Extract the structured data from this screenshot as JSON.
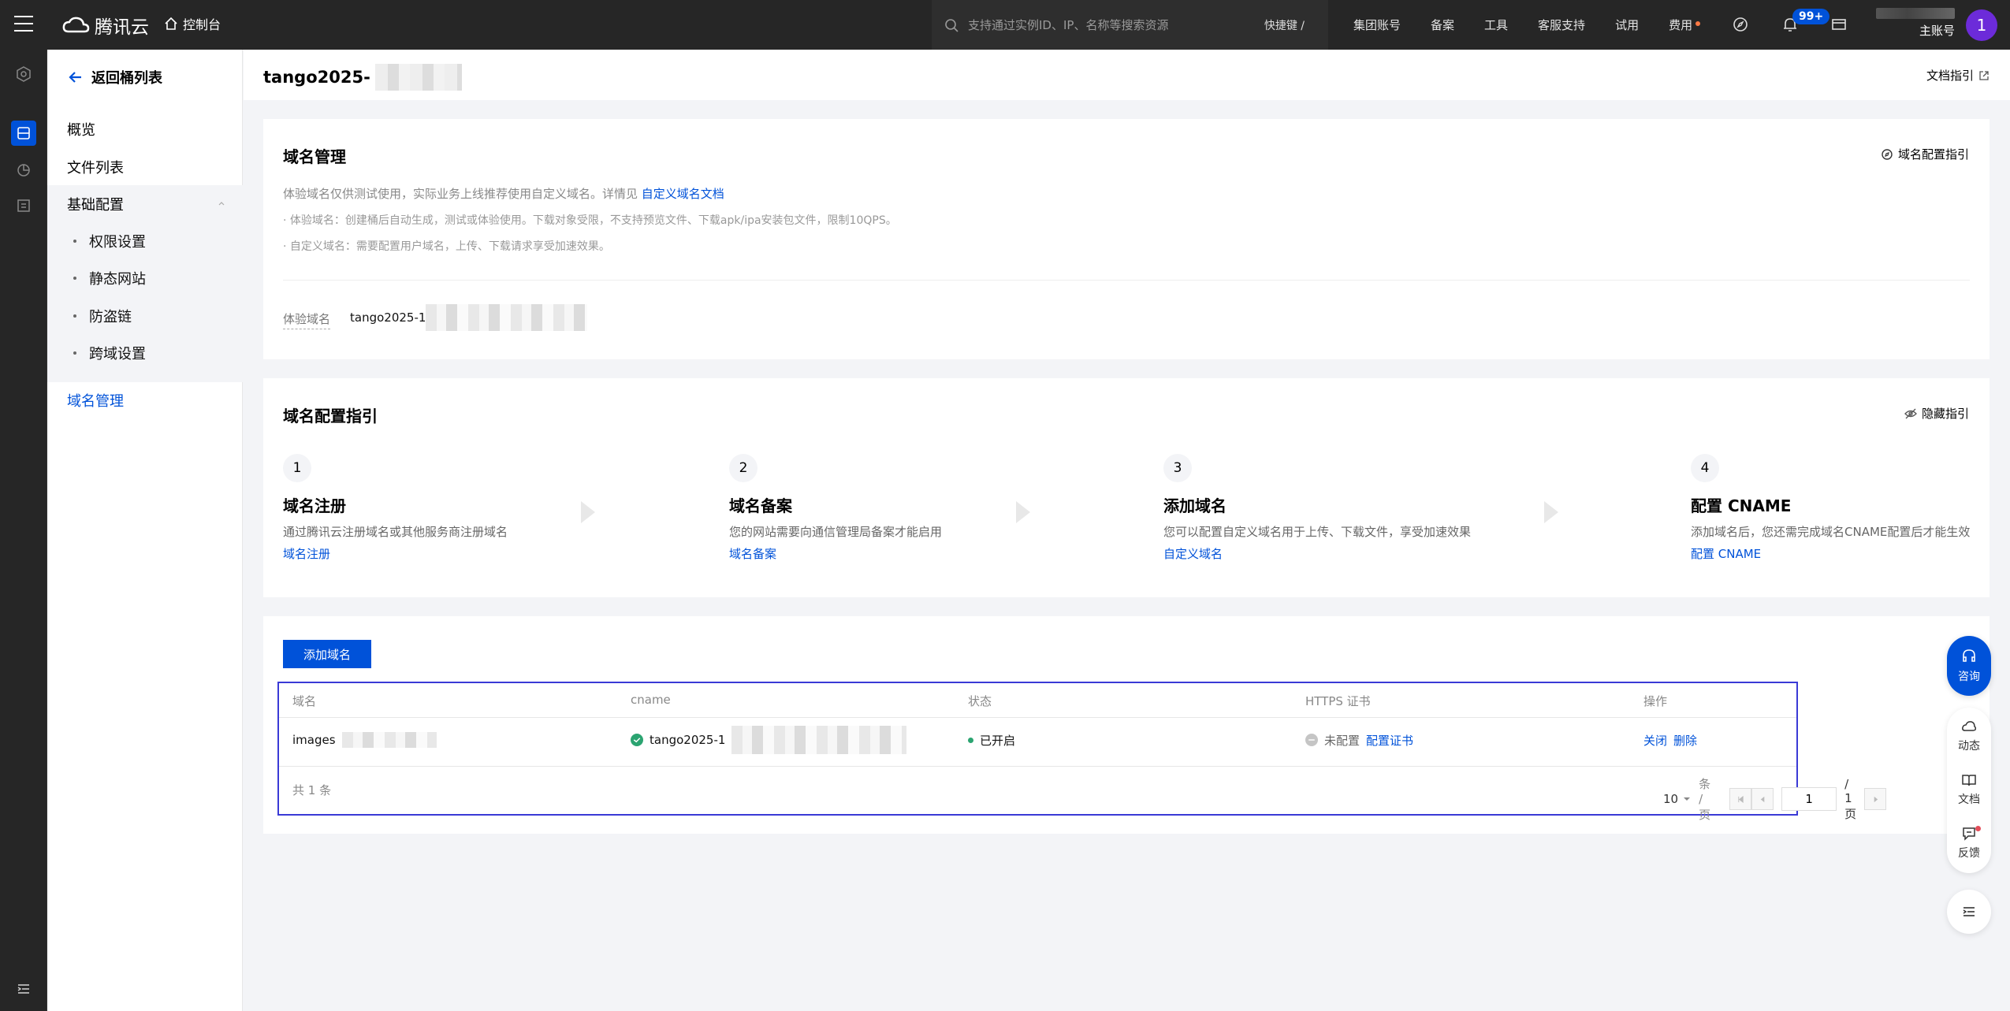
{
  "topbar": {
    "brand": "腾讯云",
    "console": "控制台",
    "search_placeholder": "支持通过实例ID、IP、名称等搜索资源",
    "shortcut": "快捷键 /",
    "nav": [
      "集团账号",
      "备案",
      "工具",
      "客服支持",
      "试用",
      "费用"
    ],
    "badge": "99+",
    "account_type": "主账号",
    "avatar": "1"
  },
  "sidebar": {
    "back": "返回桶列表",
    "items": [
      "概览",
      "文件列表",
      "基础配置"
    ],
    "subitems": [
      "权限设置",
      "静态网站",
      "防盗链",
      "跨域设置"
    ],
    "active": "域名管理"
  },
  "header": {
    "bucket": "tango2025-",
    "doc_guide": "文档指引"
  },
  "domain_card": {
    "title": "域名管理",
    "guide_link": "域名配置指引",
    "intro": "体验域名仅供测试使用，实际业务上线推荐使用自定义域名。详情见",
    "intro_link": "自定义域名文档",
    "bullet1": "· 体验域名：创建桶后自动生成，测试或体验使用。下载对象受限，不支持预览文件、下载apk/ipa安装包文件，限制10QPS。",
    "bullet2": "· 自定义域名：需要配置用户域名，上传、下载请求享受加速效果。",
    "trial_label": "体验域名",
    "trial_value": "tango2025-1"
  },
  "guide_card": {
    "title": "域名配置指引",
    "hide": "隐藏指引",
    "steps": [
      {
        "num": "1",
        "title": "域名注册",
        "desc": "通过腾讯云注册域名或其他服务商注册域名",
        "link": "域名注册"
      },
      {
        "num": "2",
        "title": "域名备案",
        "desc": "您的网站需要向通信管理局备案才能启用",
        "link": "域名备案"
      },
      {
        "num": "3",
        "title": "添加域名",
        "desc": "您可以配置自定义域名用于上传、下载文件，享受加速效果",
        "link": "自定义域名"
      },
      {
        "num": "4",
        "title": "配置 CNAME",
        "desc": "添加域名后，您还需完成域名CNAME配置后才能生效",
        "link": "配置 CNAME"
      }
    ]
  },
  "table": {
    "add_button": "添加域名",
    "columns": [
      "域名",
      "cname",
      "状态",
      "HTTPS 证书",
      "操作"
    ],
    "row": {
      "domain": "images",
      "cname": "tango2025-1",
      "status": "已开启",
      "https": "未配置",
      "https_action": "配置证书",
      "op_close": "关闭",
      "op_delete": "删除"
    },
    "total": "共 1 条",
    "page_size": "10",
    "page_size_unit": "条 / 页",
    "page_current": "1",
    "page_total": "/ 1 页"
  },
  "floating": {
    "consult": "咨询",
    "items": [
      "动态",
      "文档",
      "反馈"
    ]
  },
  "colors": {
    "brand_blue": "#0052d9",
    "topbar": "#262626",
    "success": "#2ba471",
    "highlight_box": "#3a3ad6"
  }
}
